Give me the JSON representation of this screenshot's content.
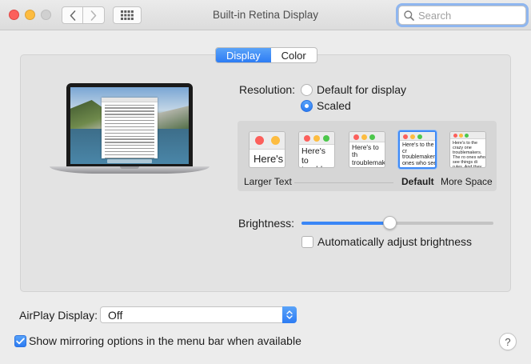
{
  "window": {
    "title": "Built-in Retina Display",
    "search_placeholder": "Search"
  },
  "toolbar": {
    "back_icon": "chevron-left-icon",
    "forward_icon": "chevron-right-icon",
    "show_all_icon": "grid-icon"
  },
  "tabs": [
    {
      "label": "Display",
      "selected": true
    },
    {
      "label": "Color",
      "selected": false
    }
  ],
  "resolution": {
    "label": "Resolution:",
    "options": [
      {
        "label": "Default for display",
        "selected": false
      },
      {
        "label": "Scaled",
        "selected": true
      }
    ],
    "scale_options": [
      {
        "preview_text": "Here's",
        "selected": false
      },
      {
        "preview_text": "Here's to troublem",
        "selected": false
      },
      {
        "preview_text": "Here's to th troublemake ones who se",
        "selected": false
      },
      {
        "preview_text": "Here's to the cr troublemakers. ones who see t rules. And they",
        "selected": true
      },
      {
        "preview_text": "Here's to the crazy one troublemakers. The ro ones who see things di rules. And they have n can quote them, disagr them. About the only th Because they change th",
        "selected": false
      }
    ],
    "captions": {
      "left": "Larger Text",
      "default": "Default",
      "right": "More Space"
    }
  },
  "brightness": {
    "label": "Brightness:",
    "value": 0.46,
    "auto_adjust_label": "Automatically adjust brightness",
    "auto_adjust_checked": false
  },
  "airplay": {
    "label": "AirPlay Display:",
    "value": "Off"
  },
  "mirroring": {
    "label": "Show mirroring options in the menu bar when available",
    "checked": true
  },
  "help_label": "?",
  "colors": {
    "accent": "#2d7cf4",
    "close": "#fc605c",
    "minimize": "#fdbc40",
    "maximize": "#d0d0d0"
  }
}
